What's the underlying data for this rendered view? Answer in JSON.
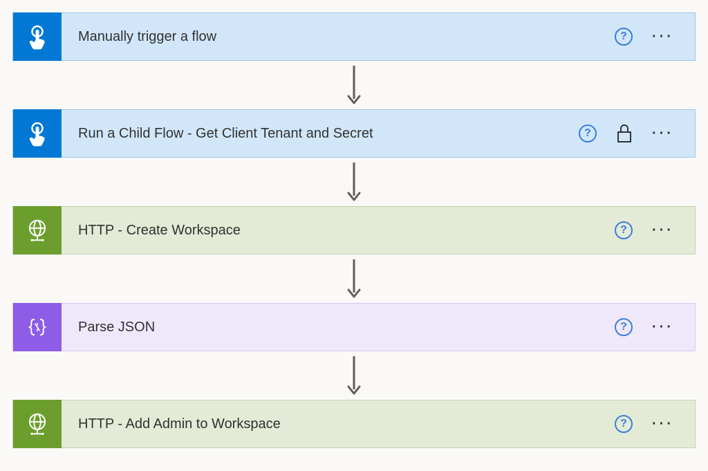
{
  "steps": [
    {
      "label": "Manually trigger a flow",
      "color": "blue",
      "iconBg": "blue-bg",
      "icon": "touch",
      "hasLock": false
    },
    {
      "label": "Run a Child Flow - Get Client Tenant and Secret",
      "color": "blue",
      "iconBg": "blue-bg",
      "icon": "touch",
      "hasLock": true
    },
    {
      "label": "HTTP - Create Workspace",
      "color": "green",
      "iconBg": "green-bg",
      "icon": "globe",
      "hasLock": false
    },
    {
      "label": "Parse JSON",
      "color": "purple",
      "iconBg": "purple-bg",
      "icon": "braces",
      "hasLock": false
    },
    {
      "label": "HTTP - Add Admin to Workspace",
      "color": "green",
      "iconBg": "green-bg",
      "icon": "globe",
      "hasLock": false
    }
  ],
  "helpGlyph": "?",
  "moreGlyph": "···"
}
